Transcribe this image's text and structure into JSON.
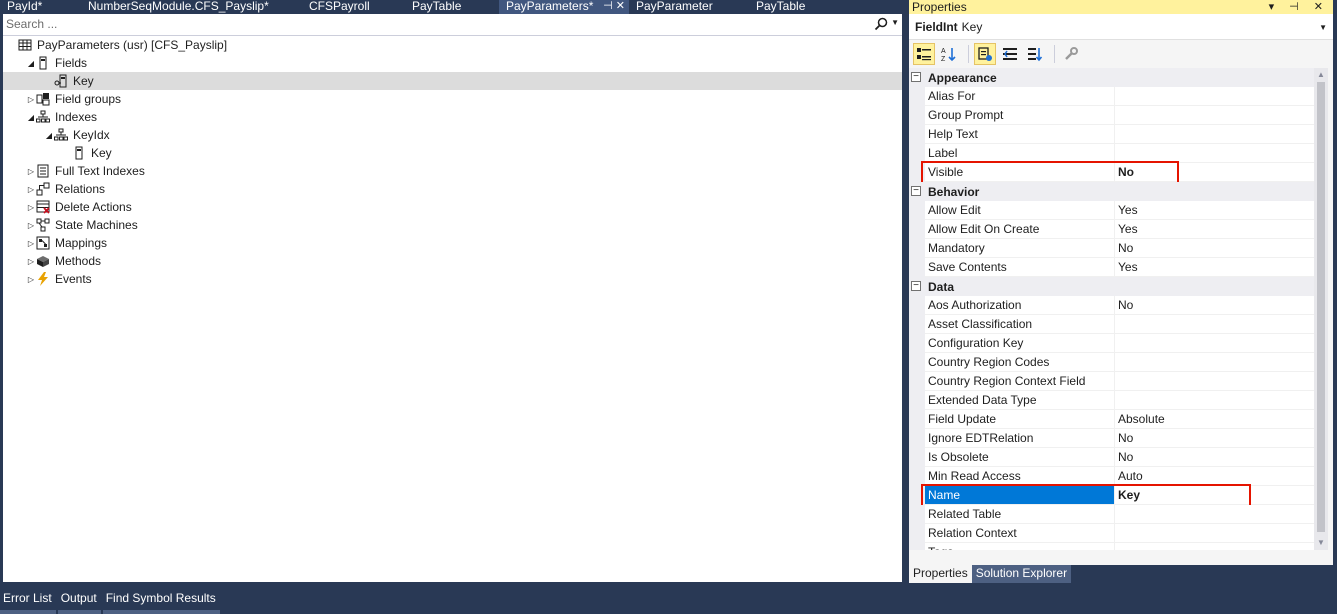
{
  "tabs": [
    {
      "label": "PayId*",
      "active": false
    },
    {
      "label": "NumberSeqModule.CFS_Payslip*",
      "active": false
    },
    {
      "label": "CFSPayroll",
      "active": false
    },
    {
      "label": "PayTable",
      "active": false
    },
    {
      "label": "PayParameters*",
      "active": true
    },
    {
      "label": "PayParameter",
      "active": false
    },
    {
      "label": "PayTable",
      "active": false
    }
  ],
  "active_tab_glyphs": "⊣ ✕",
  "search": {
    "placeholder": "Search ..."
  },
  "tree": [
    {
      "label": "PayParameters (usr) [CFS_Payslip]",
      "icon": "table-icon",
      "expander": "none",
      "selected": false
    },
    {
      "label": "Fields",
      "icon": "field-icon",
      "expander": "expanded",
      "selected": false
    },
    {
      "label": "Key",
      "icon": "key-field-icon",
      "expander": "none",
      "selected": true
    },
    {
      "label": "Field groups",
      "icon": "field-group-icon",
      "expander": "collapsed",
      "selected": false
    },
    {
      "label": "Indexes",
      "icon": "index-icon",
      "expander": "expanded",
      "selected": false
    },
    {
      "label": "KeyIdx",
      "icon": "index-icon",
      "expander": "expanded",
      "selected": false
    },
    {
      "label": "Key",
      "icon": "field-icon",
      "expander": "none",
      "selected": false
    },
    {
      "label": "Full Text Indexes",
      "icon": "fulltext-index-icon",
      "expander": "collapsed",
      "selected": false
    },
    {
      "label": "Relations",
      "icon": "relation-icon",
      "expander": "collapsed",
      "selected": false
    },
    {
      "label": "Delete Actions",
      "icon": "delete-action-icon",
      "expander": "collapsed",
      "selected": false
    },
    {
      "label": "State Machines",
      "icon": "state-machine-icon",
      "expander": "collapsed",
      "selected": false
    },
    {
      "label": "Mappings",
      "icon": "mapping-icon",
      "expander": "collapsed",
      "selected": false
    },
    {
      "label": "Methods",
      "icon": "method-icon",
      "expander": "collapsed",
      "selected": false
    },
    {
      "label": "Events",
      "icon": "event-icon",
      "expander": "collapsed",
      "selected": false
    }
  ],
  "properties": {
    "title": "Properties",
    "title_buttons": "▾ ⊣ ✕",
    "object_type": "FieldInt",
    "object_name": "Key",
    "toolbar_icons": [
      "categorized-icon",
      "alphabetical-icon",
      "properties-icon",
      "events-icon",
      "property-pages-icon",
      "wrench-icon"
    ],
    "categories": [
      {
        "name": "Appearance",
        "rows": [
          {
            "name": "Alias For",
            "value": ""
          },
          {
            "name": "Group Prompt",
            "value": ""
          },
          {
            "name": "Help Text",
            "value": ""
          },
          {
            "name": "Label",
            "value": ""
          },
          {
            "name": "Visible",
            "value": "No",
            "bold": true,
            "highlight": true
          }
        ]
      },
      {
        "name": "Behavior",
        "rows": [
          {
            "name": "Allow Edit",
            "value": "Yes"
          },
          {
            "name": "Allow Edit On Create",
            "value": "Yes"
          },
          {
            "name": "Mandatory",
            "value": "No"
          },
          {
            "name": "Save Contents",
            "value": "Yes"
          }
        ]
      },
      {
        "name": "Data",
        "rows": [
          {
            "name": "Aos Authorization",
            "value": "No"
          },
          {
            "name": "Asset Classification",
            "value": ""
          },
          {
            "name": "Configuration Key",
            "value": ""
          },
          {
            "name": "Country Region Codes",
            "value": ""
          },
          {
            "name": "Country Region Context Field",
            "value": ""
          },
          {
            "name": "Extended Data Type",
            "value": ""
          },
          {
            "name": "Field Update",
            "value": "Absolute"
          },
          {
            "name": "Ignore EDTRelation",
            "value": "No"
          },
          {
            "name": "Is Obsolete",
            "value": "No"
          },
          {
            "name": "Min Read Access",
            "value": "Auto"
          },
          {
            "name": "Name",
            "value": "Key",
            "bold": true,
            "highlight": true,
            "selected": true
          },
          {
            "name": "Related Table",
            "value": ""
          },
          {
            "name": "Relation Context",
            "value": ""
          },
          {
            "name": "Tags",
            "value": ""
          }
        ]
      }
    ],
    "panel_tabs": [
      {
        "label": "Properties",
        "active": true
      },
      {
        "label": "Solution Explorer",
        "active": false
      }
    ]
  },
  "bottom_tabs": [
    "Error List",
    "Output",
    "Find Symbol Results"
  ],
  "colors": {
    "chrome": "#293955",
    "active_tab": "#41577f",
    "properties_title": "#fff29d",
    "selection": "#0078d7",
    "highlight_box": "#e51400"
  }
}
